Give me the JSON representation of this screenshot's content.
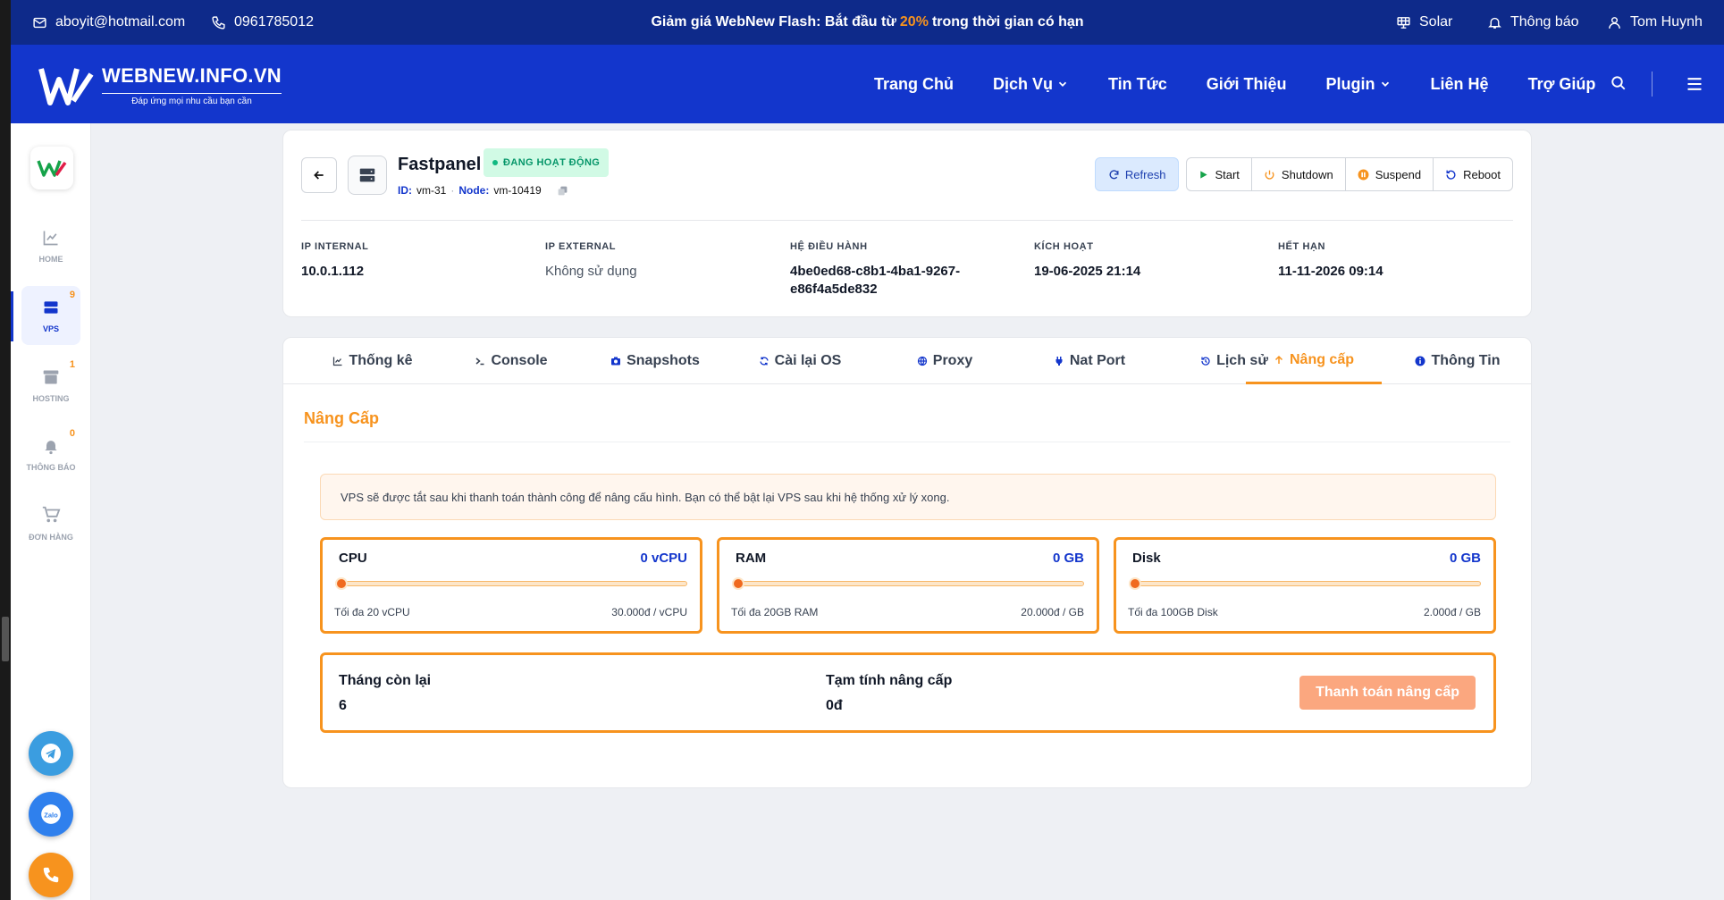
{
  "colors": {
    "topbar": "#0e2a8a",
    "nav": "#1336cc",
    "accent": "#f7931e",
    "primary": "#1336cc"
  },
  "topbar": {
    "email": "aboyit@hotmail.com",
    "phone": "0961785012",
    "promo_prefix": "Giảm giá WebNew Flash: Bắt đầu từ",
    "promo_highlight": "20%",
    "promo_suffix": "trong thời gian có hạn",
    "theme": "Solar",
    "notifications": "Thông báo",
    "user": "Tom Huynh"
  },
  "nav": {
    "brand": "WEBNEW.INFO.VN",
    "tagline": "Đáp ứng mọi nhu cầu bạn cần",
    "items": [
      {
        "label": "Trang Chủ",
        "dropdown": false
      },
      {
        "label": "Dịch Vụ",
        "dropdown": true
      },
      {
        "label": "Tin Tức",
        "dropdown": false
      },
      {
        "label": "Giới Thiệu",
        "dropdown": false
      },
      {
        "label": "Plugin",
        "dropdown": true
      },
      {
        "label": "Liên Hệ",
        "dropdown": false
      },
      {
        "label": "Trợ Giúp",
        "dropdown": false
      }
    ]
  },
  "sidebar": {
    "items": [
      {
        "label": "HOME",
        "icon": "chart-line-icon",
        "count": ""
      },
      {
        "label": "VPS",
        "icon": "server-icon",
        "count": "9"
      },
      {
        "label": "HOSTING",
        "icon": "archive-box-icon",
        "count": "1"
      },
      {
        "label": "THÔNG BÁO",
        "icon": "bell-icon",
        "count": "0"
      },
      {
        "label": "ĐƠN HÀNG",
        "icon": "cart-icon",
        "count": ""
      }
    ]
  },
  "vm": {
    "name": "Fastpanel",
    "status": "ĐANG HOẠT ĐỘNG",
    "id_label": "ID:",
    "id": "vm-31",
    "node_label": "Node:",
    "node": "vm-10419",
    "actions": {
      "refresh": "Refresh",
      "start": "Start",
      "shutdown": "Shutdown",
      "suspend": "Suspend",
      "reboot": "Reboot"
    },
    "info": [
      {
        "label": "IP INTERNAL",
        "value": "10.0.1.112"
      },
      {
        "label": "IP EXTERNAL",
        "value": "Không sử dụng"
      },
      {
        "label": "HỆ ĐIỀU HÀNH",
        "value": "4be0ed68-c8b1-4ba1-9267-e86f4a5de832"
      },
      {
        "label": "KÍCH HOẠT",
        "value": "19-06-2025 21:14"
      },
      {
        "label": "HẾT HẠN",
        "value": "11-11-2026 09:14"
      }
    ]
  },
  "tabs": [
    {
      "label": "Thống kê",
      "icon": "chart-icon",
      "active": false
    },
    {
      "label": "Console",
      "icon": "terminal-icon",
      "active": false
    },
    {
      "label": "Snapshots",
      "icon": "camera-icon",
      "active": false
    },
    {
      "label": "Cài lại OS",
      "icon": "sync-icon",
      "active": false
    },
    {
      "label": "Proxy",
      "icon": "globe-icon",
      "active": false
    },
    {
      "label": "Nat Port",
      "icon": "plug-icon",
      "active": false
    },
    {
      "label": "Lịch sử",
      "icon": "history-icon",
      "active": false
    },
    {
      "label": "Nâng cấp",
      "icon": "arrow-up-icon",
      "active": true
    },
    {
      "label": "Thông Tin",
      "icon": "info-icon",
      "active": false
    }
  ],
  "upgrade": {
    "title": "Nâng Cấp",
    "notice": "VPS sẽ được tắt sau khi thanh toán thành công để nâng cấu hình. Bạn có thể bật lại VPS sau khi hệ thống xử lý xong.",
    "resources": [
      {
        "name": "CPU",
        "amount": "0 vCPU",
        "limit": "Tối đa 20 vCPU",
        "price": "30.000đ / vCPU",
        "value": 0
      },
      {
        "name": "RAM",
        "amount": "0 GB",
        "limit": "Tối đa 20GB RAM",
        "price": "20.000đ / GB",
        "value": 0
      },
      {
        "name": "Disk",
        "amount": "0 GB",
        "limit": "Tối đa 100GB Disk",
        "price": "2.000đ / GB",
        "value": 0
      }
    ],
    "months_label": "Tháng còn lại",
    "months_value": "6",
    "estimate_label": "Tạm tính nâng cấp",
    "estimate_value": "0đ",
    "pay_button": "Thanh toán nâng cấp"
  }
}
